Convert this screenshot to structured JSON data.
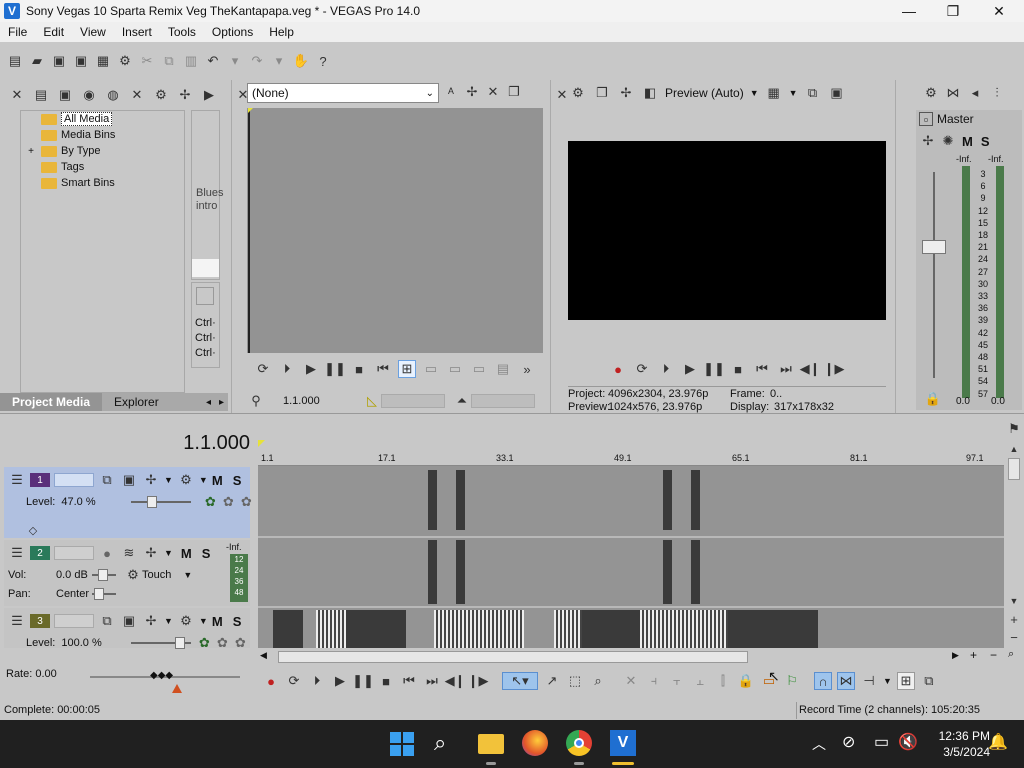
{
  "window": {
    "title": "Sony Vegas 10 Sparta Remix Veg TheKantapapa.veg * - VEGAS Pro 14.0",
    "logo": "V"
  },
  "menu": [
    "File",
    "Edit",
    "View",
    "Insert",
    "Tools",
    "Options",
    "Help"
  ],
  "media_tree": {
    "items": [
      {
        "label": "All Media",
        "expander": ""
      },
      {
        "label": "Media Bins",
        "expander": ""
      },
      {
        "label": "By Type",
        "expander": "+"
      },
      {
        "label": "Tags",
        "expander": ""
      },
      {
        "label": "Smart Bins",
        "expander": ""
      }
    ]
  },
  "side_strip": {
    "label1": "Blues",
    "label2": "intro",
    "ctrl1": "Ctrl·",
    "ctrl2": "Ctrl·",
    "ctrl3": "Ctrl·"
  },
  "panel_tabs": {
    "project_media": "Project Media",
    "explorer": "Explorer"
  },
  "trimmer": {
    "select": "(None)",
    "time": "1.1.000"
  },
  "preview": {
    "mode": "Preview (Auto)",
    "project_label": "Project:",
    "project_value": "4096x2304, 23.976p",
    "frame_label": "Frame:",
    "frame_value": "0..",
    "preview_label": "Preview:",
    "preview_value": "1024x576, 23.976p",
    "display_label": "Display:",
    "display_value": "317x178x32"
  },
  "master": {
    "title": "Master",
    "m": "M",
    "s": "S",
    "inf_left": "-Inf.",
    "inf_right": "-Inf.",
    "scale": [
      "3",
      "6",
      "9",
      "12",
      "15",
      "18",
      "21",
      "24",
      "27",
      "30",
      "33",
      "36",
      "39",
      "42",
      "45",
      "48",
      "51",
      "54",
      "57"
    ],
    "bottom_left": "0.0",
    "bottom_right": "0.0"
  },
  "timeline": {
    "time": "1.1.000",
    "ruler": [
      "1.1",
      "17.1",
      "33.1",
      "49.1",
      "65.1",
      "81.1",
      "97.1"
    ]
  },
  "tracks": [
    {
      "num": "1",
      "m": "M",
      "s": "S",
      "level_label": "Level:",
      "level_value": "47.0 %"
    },
    {
      "num": "2",
      "m": "M",
      "s": "S",
      "inf": "-Inf.",
      "vol_label": "Vol:",
      "vol_value": "0.0 dB",
      "touch": "Touch",
      "pan_label": "Pan:",
      "pan_value": "Center",
      "meter": [
        "12",
        "24",
        "36",
        "48"
      ]
    },
    {
      "num": "3",
      "m": "M",
      "s": "S",
      "level_label": "Level:",
      "level_value": "100.0 %"
    }
  ],
  "rate": "Rate: 0.00",
  "status": {
    "left": "Complete: 00:00:05",
    "right": "Record Time (2 channels): 105:20:35"
  },
  "taskbar": {
    "time": "12:36 PM",
    "date": "3/5/2024"
  }
}
